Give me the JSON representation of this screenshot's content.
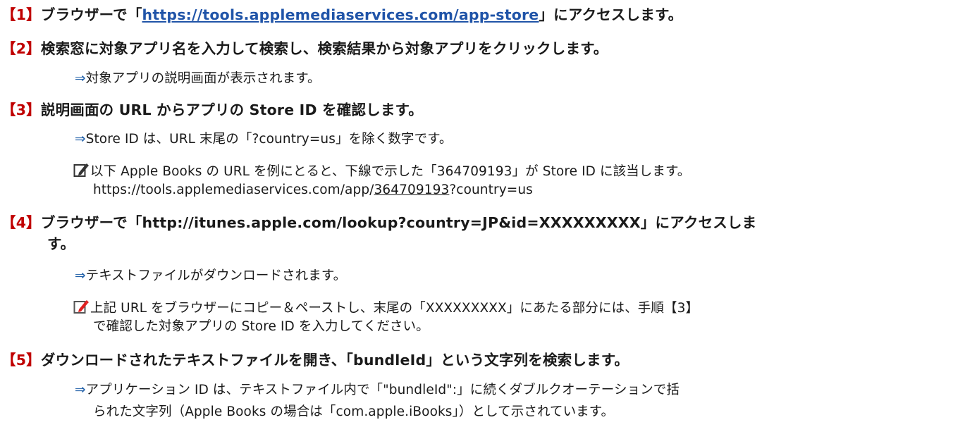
{
  "arrow": "⇒",
  "colors": {
    "step_number": "#c00000",
    "arrow": "#1f5fa8",
    "link": "#2054a8",
    "pencil_icon": "#e02020"
  },
  "step1": {
    "num": "【1】",
    "pre": "ブラウザーで「",
    "link": "https://tools.applemediaservices.com/app-store",
    "post": "」にアクセスします。"
  },
  "step2": {
    "num": "【2】",
    "text": "検索窓に対象アプリ名を入力して検索し、検索結果から対象アプリをクリックします。",
    "result": "対象アプリの説明画面が表示されます。"
  },
  "step3": {
    "num": "【3】",
    "text": "説明画面の URL からアプリの Store ID を確認します。",
    "result": "Store ID は、URL 末尾の「?country=us」を除く数字です。",
    "note_line1": "以下 Apple Books の URL を例にとると、下線で示した「364709193」が Store ID に該当します。",
    "url_prefix": "https://tools.applemediaservices.com/app/",
    "url_id": "364709193",
    "url_suffix": "?country=us"
  },
  "step4": {
    "num": "【4】",
    "pre": "ブラウザーで「",
    "url": "http://itunes.apple.com/lookup?country=JP&id=XXXXXXXXX",
    "post": "」にアクセスしま",
    "post_wrap": "す。",
    "result": "テキストファイルがダウンロードされます。",
    "note_line1": "上記 URL をブラウザーにコピー＆ペーストし、末尾の「XXXXXXXXX」にあたる部分には、手順【3】",
    "note_line2": "で確認した対象アプリの Store ID を入力してください。"
  },
  "step5": {
    "num": "【5】",
    "text": "ダウンロードされたテキストファイルを開き、「bundleId」という文字列を検索します。",
    "result_line1": "アプリケーション ID は、テキストファイル内で「\"bundleId\":」に続くダブルクオーテーションで括",
    "result_line2": "られた文字列（Apple Books の場合は「com.apple.iBooks」）として示されています。"
  }
}
